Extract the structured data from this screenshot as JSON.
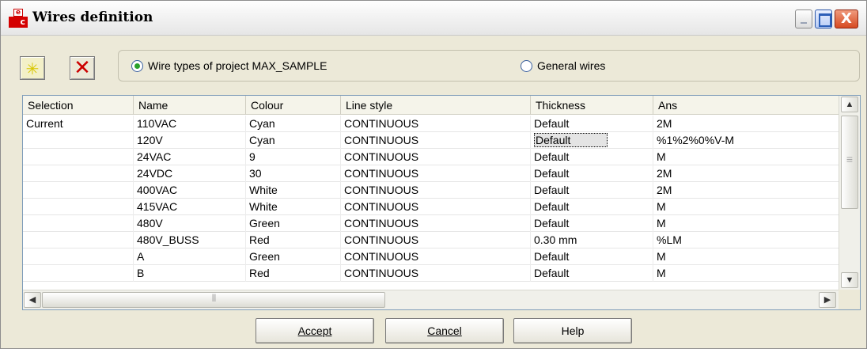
{
  "window": {
    "title": "Wires definition",
    "icon_top": "e",
    "icon_bottom": "c",
    "close_glyph": "X"
  },
  "toolbar": {
    "new_icon": "star-icon",
    "delete_icon": "x-icon"
  },
  "radio": {
    "project_label": "Wire types of project MAX_SAMPLE",
    "general_label": "General wires",
    "selected": "project"
  },
  "columns": [
    "Selection",
    "Name",
    "Colour",
    "Line style",
    "Thickness",
    "Ans"
  ],
  "rows": [
    [
      "Current",
      "110VAC",
      "Cyan",
      "CONTINUOUS",
      "Default",
      "2M"
    ],
    [
      "",
      "120V",
      "Cyan",
      "CONTINUOUS",
      "Default",
      "%1%2%0%V-M"
    ],
    [
      "",
      "24VAC",
      "9",
      "CONTINUOUS",
      "Default",
      "M"
    ],
    [
      "",
      "24VDC",
      "30",
      "CONTINUOUS",
      "Default",
      "2M"
    ],
    [
      "",
      "400VAC",
      "White",
      "CONTINUOUS",
      "Default",
      "2M"
    ],
    [
      "",
      "415VAC",
      "White",
      "CONTINUOUS",
      "Default",
      "M"
    ],
    [
      "",
      "480V",
      "Green",
      "CONTINUOUS",
      "Default",
      "M"
    ],
    [
      "",
      "480V_BUSS",
      "Red",
      "CONTINUOUS",
      "0.30 mm",
      "%LM"
    ],
    [
      "",
      "A",
      "Green",
      "CONTINUOUS",
      "Default",
      "M"
    ],
    [
      "",
      "B",
      "Red",
      "CONTINUOUS",
      "Default",
      "M"
    ]
  ],
  "scroll": {
    "up": "▲",
    "down": "▼",
    "left": "◀",
    "right": "▶"
  },
  "buttons": {
    "accept": "Accept",
    "cancel": "Cancel",
    "help": "Help"
  },
  "colors": {
    "window_bg": "#ece9d8",
    "radio_checked": "#2aa12a",
    "delete_icon": "#cc0000"
  }
}
